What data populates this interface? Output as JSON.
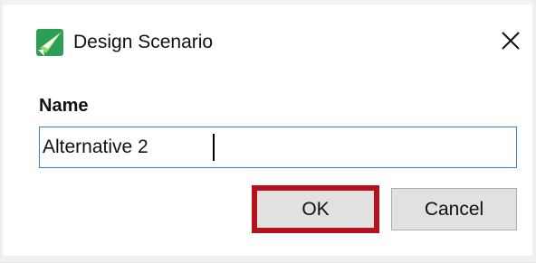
{
  "dialog": {
    "title": "Design Scenario",
    "icon": "design-scenario-app-icon",
    "close_icon": "close-icon"
  },
  "form": {
    "name_label": "Name",
    "name_value": "Alternative 2"
  },
  "buttons": {
    "ok_label": "OK",
    "cancel_label": "Cancel"
  },
  "colors": {
    "input_focus_border": "#3c7fd1",
    "highlight_border": "#b5121b",
    "button_background": "#e1e1e1"
  }
}
